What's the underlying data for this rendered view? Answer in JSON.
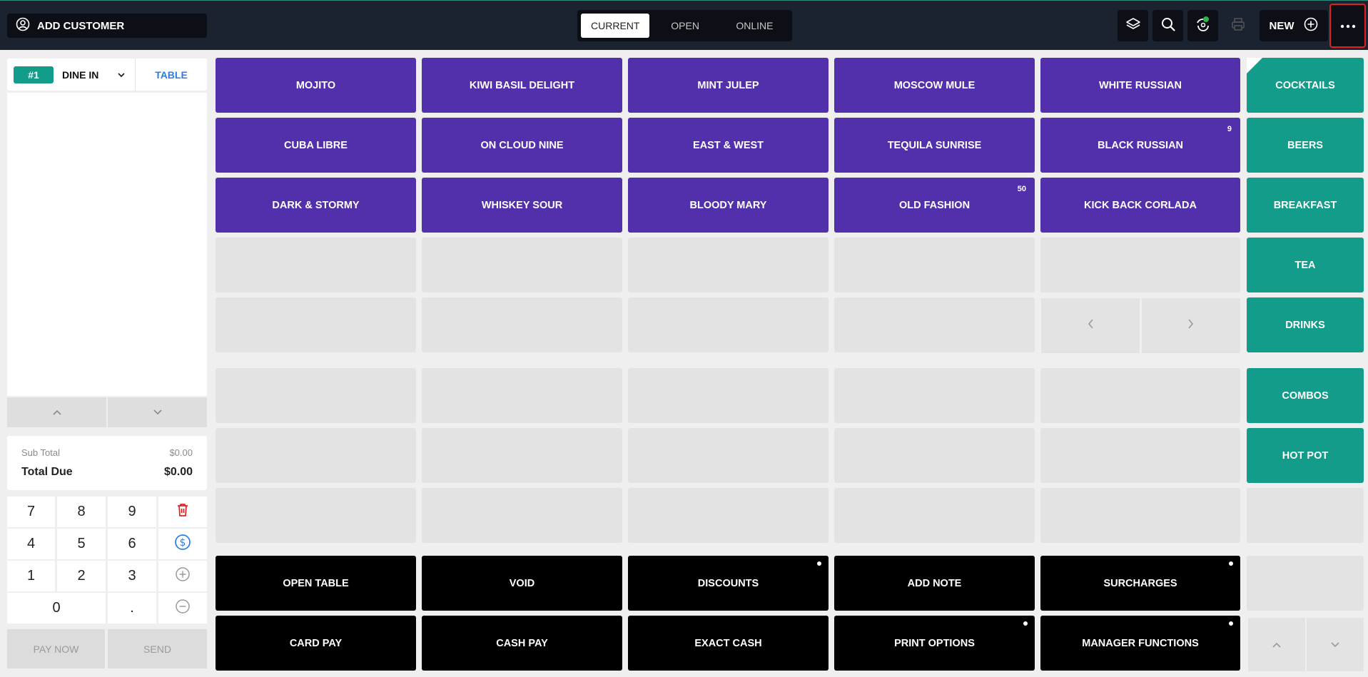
{
  "header": {
    "add_customer": "ADD CUSTOMER",
    "tabs": [
      {
        "label": "CURRENT"
      },
      {
        "label": "OPEN"
      },
      {
        "label": "ONLINE"
      }
    ],
    "new_label": "NEW"
  },
  "order": {
    "number": "#1",
    "type": "DINE IN",
    "table_label": "TABLE"
  },
  "totals": {
    "sub_total_label": "Sub Total",
    "sub_total_value": "$0.00",
    "total_due_label": "Total Due",
    "total_due_value": "$0.00"
  },
  "keypad": {
    "k7": "7",
    "k8": "8",
    "k9": "9",
    "k4": "4",
    "k5": "5",
    "k6": "6",
    "k1": "1",
    "k2": "2",
    "k3": "3",
    "k0": "0",
    "kdot": "."
  },
  "actions": {
    "pay_now": "PAY NOW",
    "send": "SEND"
  },
  "products": {
    "mojito": "MOJITO",
    "kiwi": "KIWI BASIL DELIGHT",
    "mint": "MINT JULEP",
    "moscow": "MOSCOW MULE",
    "white": "WHITE RUSSIAN",
    "cuba": "CUBA LIBRE",
    "cloud": "ON CLOUD NINE",
    "eastwest": "EAST & WEST",
    "tequila": "TEQUILA SUNRISE",
    "black": "BLACK RUSSIAN",
    "black_badge": "9",
    "dark": "DARK & STORMY",
    "whiskey": "WHISKEY SOUR",
    "bloody": "BLOODY MARY",
    "oldfashion": "OLD FASHION",
    "oldfashion_badge": "50",
    "kickback": "KICK BACK CORLADA"
  },
  "categories": {
    "cocktails": "COCKTAILS",
    "beers": "BEERS",
    "breakfast": "BREAKFAST",
    "tea": "TEA",
    "drinks": "DRINKS",
    "combos": "COMBOS",
    "hotpot": "HOT POT"
  },
  "functions": {
    "open_table": "OPEN TABLE",
    "void": "VOID",
    "discounts": "DISCOUNTS",
    "add_note": "ADD NOTE",
    "surcharges": "SURCHARGES",
    "card_pay": "CARD PAY",
    "cash_pay": "CASH PAY",
    "exact_cash": "EXACT CASH",
    "print_options": "PRINT OPTIONS",
    "manager_functions": "MANAGER FUNCTIONS"
  },
  "colors": {
    "product": "#5330ab",
    "category": "#149c8a",
    "function": "#000000",
    "header": "#1b2230",
    "delete": "#e02020",
    "accent_blue": "#2b7de1"
  }
}
